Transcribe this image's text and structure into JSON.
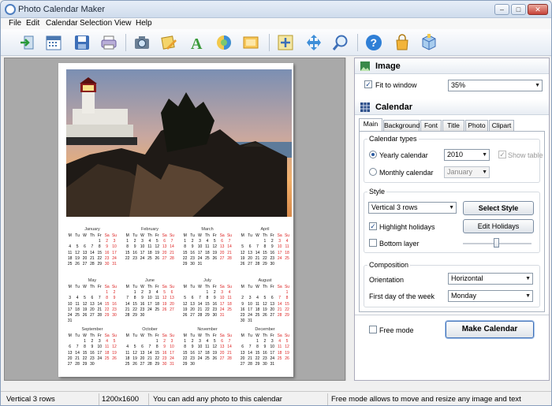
{
  "window": {
    "title": "Photo Calendar Maker",
    "buttons": {
      "minimize": "–",
      "maximize": "□",
      "close": "✕"
    }
  },
  "menu": [
    "File",
    "Edit",
    "Calendar",
    "Selection",
    "View",
    "Help"
  ],
  "toolbar": {
    "icons": [
      "exit-icon",
      "calendar-icon",
      "save-icon",
      "print-icon",
      "camera-icon",
      "edit-photo-icon",
      "text-icon",
      "clipart-icon",
      "background-icon",
      "fit-icon",
      "move-icon",
      "zoom-icon",
      "help-icon",
      "buy-icon",
      "package-icon"
    ]
  },
  "calendar": {
    "weekdays": [
      "M",
      "Tu",
      "W",
      "Th",
      "Fr",
      "Sa",
      "Su"
    ],
    "months": [
      {
        "name": "January",
        "days": [
          [
            "",
            "",
            "",
            "",
            "1",
            "2",
            "3"
          ],
          [
            "4",
            "5",
            "6",
            "7",
            "8",
            "9",
            "10"
          ],
          [
            "11",
            "12",
            "13",
            "14",
            "15",
            "16",
            "17"
          ],
          [
            "18",
            "19",
            "20",
            "21",
            "22",
            "23",
            "24"
          ],
          [
            "25",
            "26",
            "27",
            "28",
            "29",
            "30",
            "31"
          ]
        ]
      },
      {
        "name": "February",
        "days": [
          [
            "1",
            "2",
            "3",
            "4",
            "5",
            "6",
            "7"
          ],
          [
            "8",
            "9",
            "10",
            "11",
            "12",
            "13",
            "14"
          ],
          [
            "15",
            "16",
            "17",
            "18",
            "19",
            "20",
            "21"
          ],
          [
            "22",
            "23",
            "24",
            "25",
            "26",
            "27",
            "28"
          ]
        ]
      },
      {
        "name": "March",
        "days": [
          [
            "1",
            "2",
            "3",
            "4",
            "5",
            "6",
            "7"
          ],
          [
            "8",
            "9",
            "10",
            "11",
            "12",
            "13",
            "14"
          ],
          [
            "15",
            "16",
            "17",
            "18",
            "19",
            "20",
            "21"
          ],
          [
            "22",
            "23",
            "24",
            "25",
            "26",
            "27",
            "28"
          ],
          [
            "29",
            "30",
            "31",
            "",
            "",
            "",
            ""
          ]
        ]
      },
      {
        "name": "April",
        "days": [
          [
            "",
            "",
            "",
            "1",
            "2",
            "3",
            "4"
          ],
          [
            "5",
            "6",
            "7",
            "8",
            "9",
            "10",
            "11"
          ],
          [
            "12",
            "13",
            "14",
            "15",
            "16",
            "17",
            "18"
          ],
          [
            "19",
            "20",
            "21",
            "22",
            "23",
            "24",
            "25"
          ],
          [
            "26",
            "27",
            "28",
            "29",
            "30",
            "",
            ""
          ]
        ]
      },
      {
        "name": "May",
        "days": [
          [
            "",
            "",
            "",
            "",
            "",
            "1",
            "2"
          ],
          [
            "3",
            "4",
            "5",
            "6",
            "7",
            "8",
            "9"
          ],
          [
            "10",
            "11",
            "12",
            "13",
            "14",
            "15",
            "16"
          ],
          [
            "17",
            "18",
            "19",
            "20",
            "21",
            "22",
            "23"
          ],
          [
            "24",
            "25",
            "26",
            "27",
            "28",
            "29",
            "30"
          ],
          [
            "31",
            "",
            "",
            "",
            "",
            "",
            ""
          ]
        ]
      },
      {
        "name": "June",
        "days": [
          [
            "",
            "1",
            "2",
            "3",
            "4",
            "5",
            "6"
          ],
          [
            "7",
            "8",
            "9",
            "10",
            "11",
            "12",
            "13"
          ],
          [
            "14",
            "15",
            "16",
            "17",
            "18",
            "19",
            "20"
          ],
          [
            "21",
            "22",
            "23",
            "24",
            "25",
            "26",
            "27"
          ],
          [
            "28",
            "29",
            "30",
            "",
            "",
            "",
            ""
          ]
        ]
      },
      {
        "name": "July",
        "days": [
          [
            "",
            "",
            "",
            "1",
            "2",
            "3",
            "4"
          ],
          [
            "5",
            "6",
            "7",
            "8",
            "9",
            "10",
            "11"
          ],
          [
            "12",
            "13",
            "14",
            "15",
            "16",
            "17",
            "18"
          ],
          [
            "19",
            "20",
            "21",
            "22",
            "23",
            "24",
            "25"
          ],
          [
            "26",
            "27",
            "28",
            "29",
            "30",
            "31",
            ""
          ]
        ]
      },
      {
        "name": "August",
        "days": [
          [
            "",
            "",
            "",
            "",
            "",
            "",
            "1"
          ],
          [
            "2",
            "3",
            "4",
            "5",
            "6",
            "7",
            "8"
          ],
          [
            "9",
            "10",
            "11",
            "12",
            "13",
            "14",
            "15"
          ],
          [
            "16",
            "17",
            "18",
            "19",
            "20",
            "21",
            "22"
          ],
          [
            "23",
            "24",
            "25",
            "26",
            "27",
            "28",
            "29"
          ],
          [
            "30",
            "31",
            "",
            "",
            "",
            "",
            ""
          ]
        ]
      },
      {
        "name": "September",
        "days": [
          [
            "",
            "",
            "1",
            "2",
            "3",
            "4",
            "5"
          ],
          [
            "6",
            "7",
            "8",
            "9",
            "10",
            "11",
            "12"
          ],
          [
            "13",
            "14",
            "15",
            "16",
            "17",
            "18",
            "19"
          ],
          [
            "20",
            "21",
            "22",
            "23",
            "24",
            "25",
            "26"
          ],
          [
            "27",
            "28",
            "29",
            "30",
            "",
            "",
            ""
          ]
        ]
      },
      {
        "name": "October",
        "days": [
          [
            "",
            "",
            "",
            "",
            "1",
            "2",
            "3"
          ],
          [
            "4",
            "5",
            "6",
            "7",
            "8",
            "9",
            "10"
          ],
          [
            "11",
            "12",
            "13",
            "14",
            "15",
            "16",
            "17"
          ],
          [
            "18",
            "19",
            "20",
            "21",
            "22",
            "23",
            "24"
          ],
          [
            "25",
            "26",
            "27",
            "28",
            "29",
            "30",
            "31"
          ]
        ]
      },
      {
        "name": "November",
        "days": [
          [
            "1",
            "2",
            "3",
            "4",
            "5",
            "6",
            "7"
          ],
          [
            "8",
            "9",
            "10",
            "11",
            "12",
            "13",
            "14"
          ],
          [
            "15",
            "16",
            "17",
            "18",
            "19",
            "20",
            "21"
          ],
          [
            "22",
            "23",
            "24",
            "25",
            "26",
            "27",
            "28"
          ],
          [
            "29",
            "30",
            "",
            "",
            "",
            "",
            ""
          ]
        ]
      },
      {
        "name": "December",
        "days": [
          [
            "",
            "",
            "1",
            "2",
            "3",
            "4",
            "5"
          ],
          [
            "6",
            "7",
            "8",
            "9",
            "10",
            "11",
            "12"
          ],
          [
            "13",
            "14",
            "15",
            "16",
            "17",
            "18",
            "19"
          ],
          [
            "20",
            "21",
            "22",
            "23",
            "24",
            "25",
            "26"
          ],
          [
            "27",
            "28",
            "29",
            "30",
            "31",
            "",
            ""
          ]
        ]
      }
    ]
  },
  "panel": {
    "image": {
      "header": "Image",
      "fit_label": "Fit to window",
      "fit_checked": true,
      "zoom": "35%"
    },
    "calendar": {
      "header": "Calendar"
    },
    "tabs": [
      "Main",
      "Background",
      "Font",
      "Title",
      "Photo",
      "Clipart"
    ],
    "types": {
      "title": "Calendar types",
      "yearly": "Yearly calendar",
      "monthly": "Monthly calendar",
      "year": "2010",
      "month": "January",
      "show_table": "Show table"
    },
    "style": {
      "title": "Style",
      "value": "Vertical 3 rows",
      "select_btn": "Select Style",
      "highlight": "Highlight holidays",
      "edit_holidays": "Edit Holidays",
      "bottom": "Bottom layer"
    },
    "composition": {
      "title": "Composition",
      "orientation_label": "Orientation",
      "orientation": "Horizontal",
      "first_day_label": "First day of the week",
      "first_day": "Monday"
    },
    "free_mode": "Free mode",
    "make": "Make Calendar"
  },
  "status": {
    "layout": "Vertical 3 rows",
    "size": "1200x1600",
    "hint": "You can add any photo to this calendar",
    "free_hint": "Free mode allows to move and resize any image and text"
  },
  "colors": {
    "accent": "#2a5aa0",
    "holiday": "#d22222"
  }
}
